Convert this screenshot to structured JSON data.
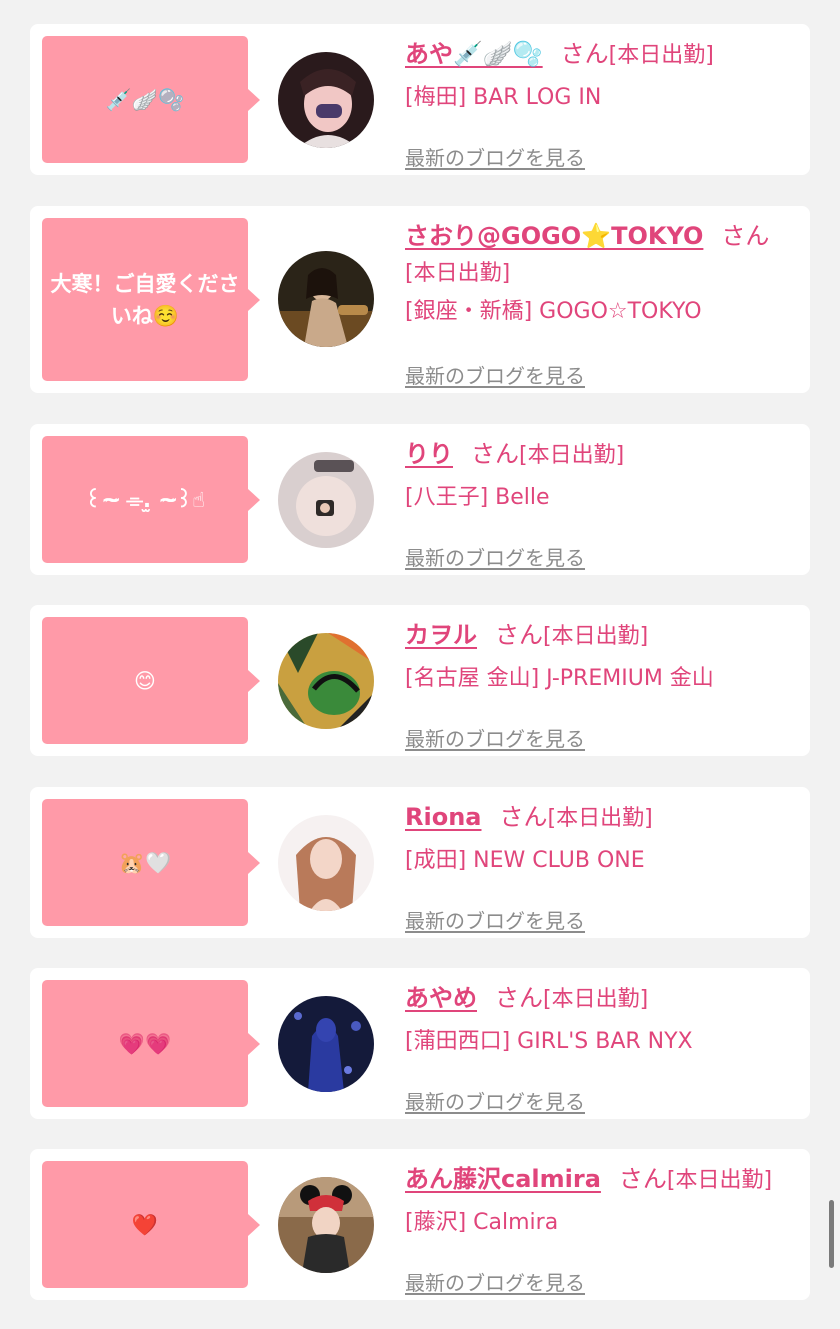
{
  "entries": [
    {
      "bubble": "💉🪽🫧",
      "name": "あや💉🪽🫧",
      "suffix": "さん",
      "status": "[本日出勤]",
      "shop": "[梅田] BAR LOG IN",
      "blog_link": "最新のブログを見る"
    },
    {
      "bubble": "大寒！ご自愛くださいね☺️",
      "name": "さおり@GOGO⭐TOKYO",
      "suffix": "さん",
      "status": "[本日出勤]",
      "shop": "[銀座・新橋] GOGO☆TOKYO",
      "blog_link": "最新のブログを見る"
    },
    {
      "bubble": "꒰~̴ ⌯.̫ ~̴꒱☝",
      "name": "りり",
      "suffix": "さん",
      "status": "[本日出勤]",
      "shop": "[八王子] Belle",
      "blog_link": "最新のブログを見る"
    },
    {
      "bubble": "😊",
      "name": "カヲル",
      "suffix": "さん",
      "status": "[本日出勤]",
      "shop": "[名古屋 金山] J-PREMIUM 金山",
      "blog_link": "最新のブログを見る"
    },
    {
      "bubble": "🐹🤍",
      "name": "Riona",
      "suffix": "さん",
      "status": "[本日出勤]",
      "shop": "[成田] NEW CLUB ONE",
      "blog_link": "最新のブログを見る"
    },
    {
      "bubble": "💗💗",
      "name": "あやめ",
      "suffix": "さん",
      "status": "[本日出勤]",
      "shop": "[蒲田西口] GIRL'S BAR NYX",
      "blog_link": "最新のブログを見る"
    },
    {
      "bubble": "❤️",
      "name": "あん藤沢calmira",
      "suffix": "さん",
      "status": "[本日出勤]",
      "shop": "[藤沢] Calmira",
      "blog_link": "最新のブログを見る"
    }
  ],
  "colors": {
    "accent": "#e0457b",
    "bubble": "#ff9aa8",
    "link_gray": "#8c8c8c",
    "background": "#f2f2f2"
  }
}
